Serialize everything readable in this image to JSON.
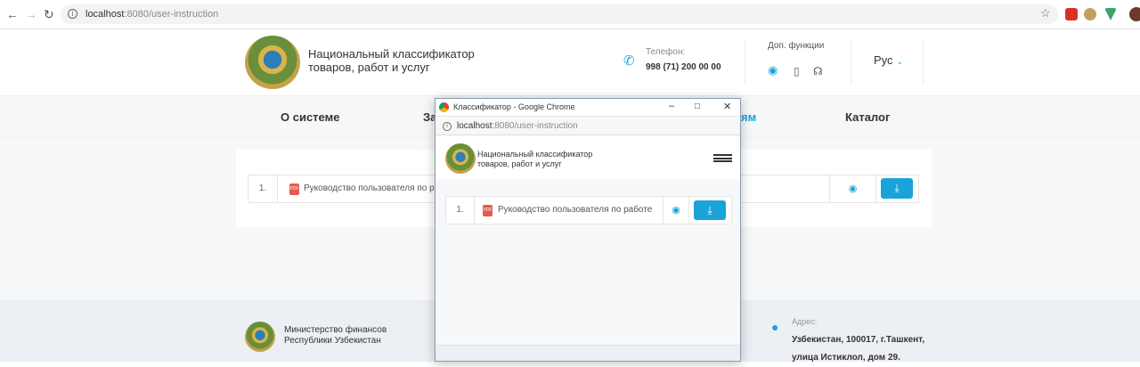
{
  "browser": {
    "url_host": "localhost",
    "url_path": ":8080/user-instruction"
  },
  "header": {
    "title_line1": "Национальный классификатор",
    "title_line2": "товаров, работ и услуг",
    "phone_label": "Телефон:",
    "phone_number": "998 (71) 200 00 00",
    "extra_label": "Доп. функции",
    "language": "Рус"
  },
  "nav": {
    "items": [
      "О системе",
      "За",
      "ям",
      "Каталог"
    ]
  },
  "documents": [
    {
      "index": "1.",
      "title": "Руководство пользователя по ра"
    }
  ],
  "footer": {
    "ministry_line1": "Министерство финансов",
    "ministry_line2": "Республики Узбекистан",
    "address_label": "Адрес:",
    "address_line1": "Узбекистан, 100017, г.Ташкент,",
    "address_line2": "улица Истиклол, дом 29."
  },
  "popup": {
    "window_title": "Классификатор - Google Chrome",
    "url_host": "localhost",
    "url_path": ":8080/user-instruction",
    "title_line1": "Национальный классификатор",
    "title_line2": "товаров, работ и услуг",
    "doc_index": "1.",
    "doc_title": "Руководство пользователя по работе"
  },
  "colors": {
    "accent": "#1aa3d9",
    "pdf": "#e55a4e"
  },
  "icons": {
    "phone": "phone-icon",
    "eye": "eye-icon",
    "mobile": "mobile-icon",
    "headphones": "headphones-icon",
    "download": "download-icon",
    "pin": "map-pin-icon"
  }
}
